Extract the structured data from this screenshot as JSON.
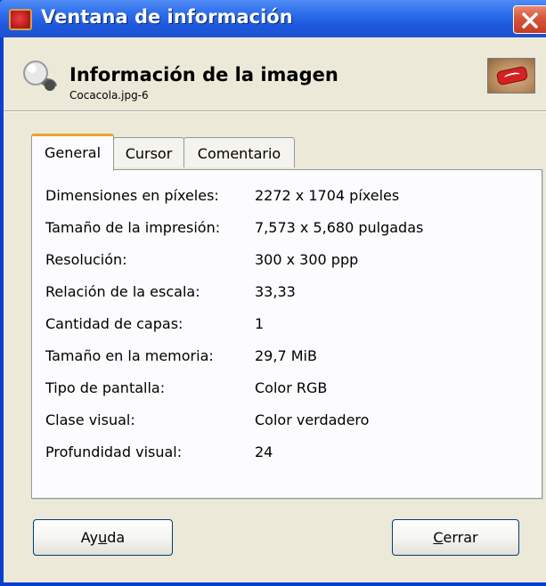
{
  "window": {
    "title": "Ventana de información"
  },
  "header": {
    "title": "Información de la imagen",
    "filename": "Cocacola.jpg-6"
  },
  "tabs": [
    {
      "label": "General",
      "active": true
    },
    {
      "label": "Cursor",
      "active": false
    },
    {
      "label": "Comentario",
      "active": false
    }
  ],
  "info": [
    {
      "label": "Dimensiones en píxeles:",
      "value": "2272 x 1704 píxeles"
    },
    {
      "label": "Tamaño de la impresión:",
      "value": "7,573 x 5,680 pulgadas"
    },
    {
      "label": "Resolución:",
      "value": "300 x 300 ppp"
    },
    {
      "label": "Relación de la escala:",
      "value": "33,33"
    },
    {
      "label": "Cantidad de capas:",
      "value": "1"
    },
    {
      "label": "Tamaño en la memoria:",
      "value": "29,7 MiB"
    },
    {
      "label": "Tipo de pantalla:",
      "value": "Color RGB"
    },
    {
      "label": "Clase visual:",
      "value": "Color verdadero"
    },
    {
      "label": "Profundidad visual:",
      "value": "24"
    }
  ],
  "buttons": {
    "help_prefix": "Ay",
    "help_mnemonic": "u",
    "help_suffix": "da",
    "close_prefix": "",
    "close_mnemonic": "C",
    "close_suffix": "errar"
  },
  "colors": {
    "titlebar": "#2f6fec",
    "dialog_bg": "#ece9d8",
    "active_tab_accent": "#f0a030",
    "close_button": "#d6553a"
  }
}
